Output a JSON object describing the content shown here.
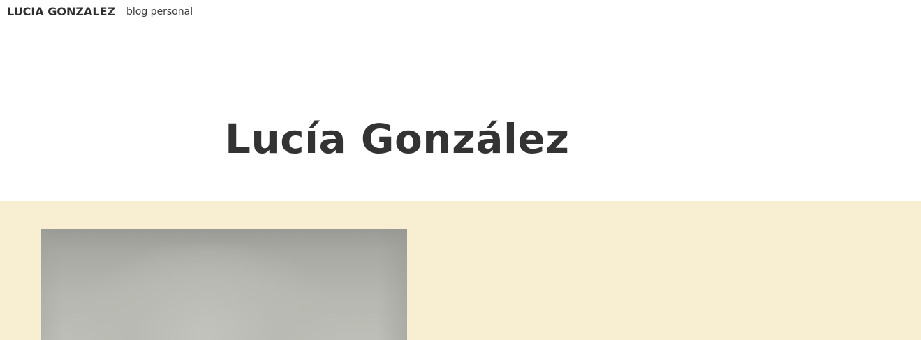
{
  "header": {
    "site_title": "LUCIA GONZALEZ",
    "tagline": "blog personal"
  },
  "hero": {
    "title": "Lucía González"
  },
  "colors": {
    "page_background": "#ffffff",
    "band_background": "#f8efd2",
    "text_primary": "#333333"
  },
  "content": {
    "photo_icon": "portrait-photo"
  }
}
